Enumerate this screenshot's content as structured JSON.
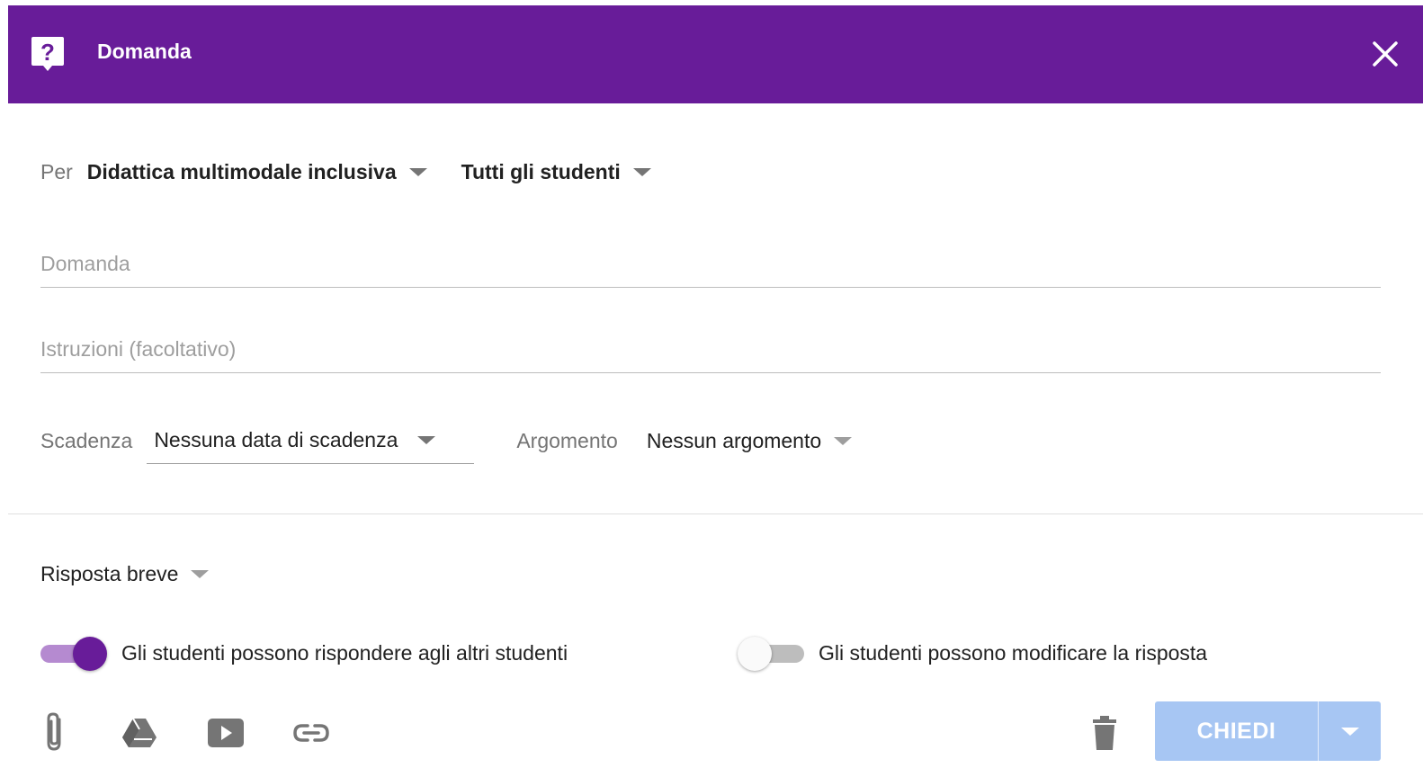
{
  "header": {
    "title": "Domanda",
    "icon": "question-mark-icon",
    "close_icon": "close-icon",
    "bg_color": "#681c99"
  },
  "assign": {
    "for_label": "Per",
    "class_value": "Didattica multimodale inclusiva",
    "students_value": "Tutti gli studenti"
  },
  "question_field": {
    "placeholder": "Domanda"
  },
  "instructions_field": {
    "placeholder": "Istruzioni (facoltativo)"
  },
  "due": {
    "label": "Scadenza",
    "value": "Nessuna data di scadenza"
  },
  "topic": {
    "label": "Argomento",
    "value": "Nessun argomento"
  },
  "answer_type": {
    "value": "Risposta breve"
  },
  "toggles": [
    {
      "label": "Gli studenti possono rispondere agli altri studenti",
      "on": true
    },
    {
      "label": "Gli studenti possono modificare la risposta",
      "on": false
    }
  ],
  "toolbar": {
    "icons": [
      "attach-icon",
      "drive-icon",
      "youtube-icon",
      "link-icon",
      "trash-icon"
    ],
    "ask_label": "CHIEDI",
    "ask_color": "#a7c6f3"
  }
}
